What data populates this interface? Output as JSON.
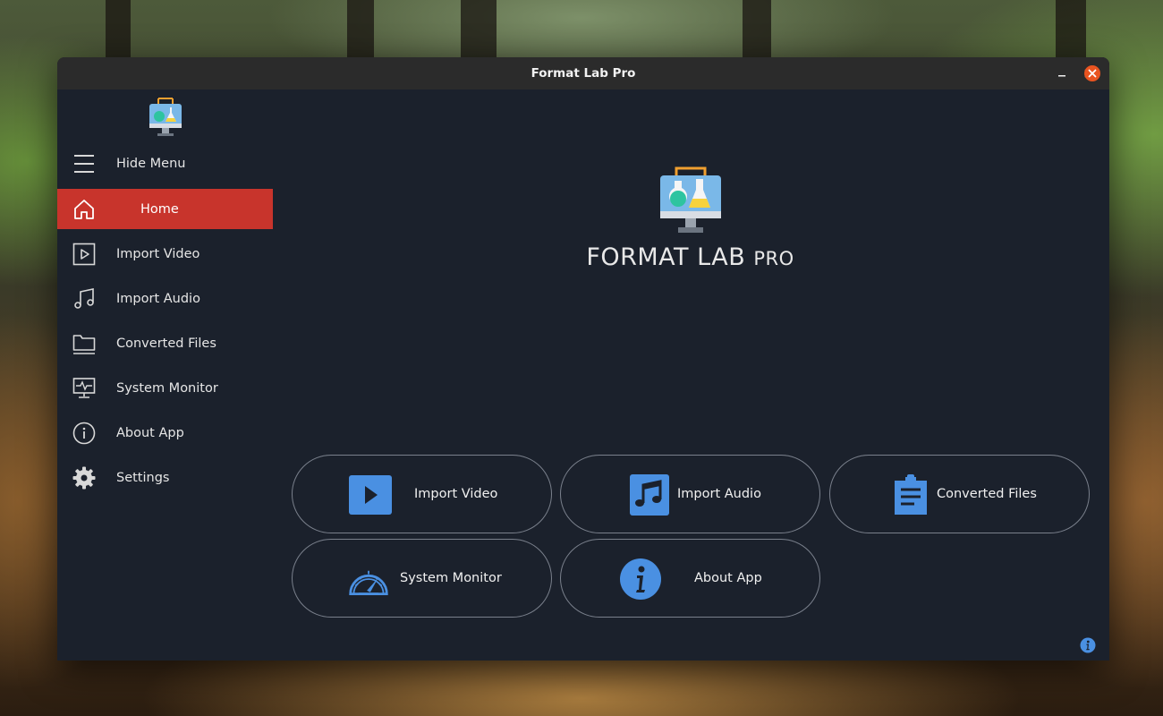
{
  "window": {
    "title": "Format Lab Pro",
    "controls": [
      "minimize-icon",
      "maximize-icon",
      "close-icon"
    ]
  },
  "sidebar": {
    "items": [
      {
        "label": "Hide Menu",
        "icon": "hamburger-icon"
      },
      {
        "label": "Home",
        "icon": "home-icon",
        "active": true
      },
      {
        "label": "Import Video",
        "icon": "play-icon"
      },
      {
        "label": "Import Audio",
        "icon": "music-note-icon"
      },
      {
        "label": "Converted Files",
        "icon": "folder-icon"
      },
      {
        "label": "System Monitor",
        "icon": "monitor-pulse-icon"
      },
      {
        "label": "About App",
        "icon": "info-icon"
      },
      {
        "label": "Settings",
        "icon": "gear-icon"
      }
    ]
  },
  "hero": {
    "title_main": "FORMAT LAB",
    "title_suffix": "PRO"
  },
  "cards": [
    {
      "label": "Import Video",
      "icon": "video-play-icon"
    },
    {
      "label": "Import Audio",
      "icon": "audio-note-icon"
    },
    {
      "label": "Converted Files",
      "icon": "clipboard-icon"
    },
    {
      "label": "System Monitor",
      "icon": "speedometer-icon"
    },
    {
      "label": "About App",
      "icon": "info-circle-icon"
    }
  ],
  "colors": {
    "window_bg": "#1b212c",
    "titlebar_bg": "#2b2b2b",
    "active_item": "#c8342c",
    "accent_blue": "#4a90e2",
    "close_button": "#e95420"
  }
}
